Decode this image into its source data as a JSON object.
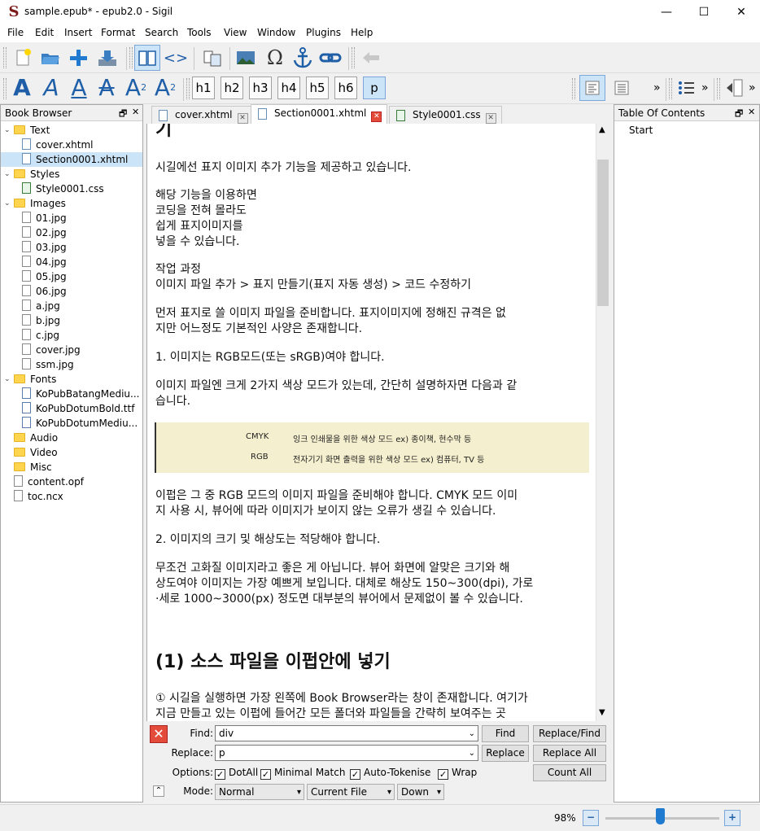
{
  "window": {
    "title": "sample.epub* - epub2.0 - Sigil",
    "logo_glyph": "S",
    "minimize_glyph": "—",
    "maximize_glyph": "☐",
    "close_glyph": "✕"
  },
  "menu": [
    "File",
    "Edit",
    "Insert",
    "Format",
    "Search",
    "Tools",
    "View",
    "Window",
    "Plugins",
    "Help"
  ],
  "toolbar_headings": [
    "h1",
    "h2",
    "h3",
    "h4",
    "h5",
    "h6",
    "p"
  ],
  "toolbar_omega": "Ω",
  "toolbar_more": "»",
  "book_browser": {
    "title": "Book Browser",
    "float_glyph": "🗗",
    "close_glyph": "✕",
    "items": [
      {
        "label": "Text",
        "kind": "folder",
        "level": 0
      },
      {
        "label": "cover.xhtml",
        "kind": "xhtml",
        "level": 1
      },
      {
        "label": "Section0001.xhtml",
        "kind": "xhtml",
        "level": 1,
        "selected": true
      },
      {
        "label": "Styles",
        "kind": "folder",
        "level": 0
      },
      {
        "label": "Style0001.css",
        "kind": "css",
        "level": 1
      },
      {
        "label": "Images",
        "kind": "folder",
        "level": 0
      },
      {
        "label": "01.jpg",
        "kind": "file",
        "level": 1
      },
      {
        "label": "02.jpg",
        "kind": "file",
        "level": 1
      },
      {
        "label": "03.jpg",
        "kind": "file",
        "level": 1
      },
      {
        "label": "04.jpg",
        "kind": "file",
        "level": 1
      },
      {
        "label": "05.jpg",
        "kind": "file",
        "level": 1
      },
      {
        "label": "06.jpg",
        "kind": "file",
        "level": 1
      },
      {
        "label": "a.jpg",
        "kind": "file",
        "level": 1
      },
      {
        "label": "b.jpg",
        "kind": "file",
        "level": 1
      },
      {
        "label": "c.jpg",
        "kind": "file",
        "level": 1
      },
      {
        "label": "cover.jpg",
        "kind": "file",
        "level": 1
      },
      {
        "label": "ssm.jpg",
        "kind": "file",
        "level": 1
      },
      {
        "label": "Fonts",
        "kind": "folder",
        "level": 0
      },
      {
        "label": "KoPubBatangMediu...",
        "kind": "font",
        "level": 1
      },
      {
        "label": "KoPubDotumBold.ttf",
        "kind": "font",
        "level": 1
      },
      {
        "label": "KoPubDotumMediu...",
        "kind": "font",
        "level": 1
      },
      {
        "label": "Audio",
        "kind": "folder",
        "level": 0,
        "noexp": true
      },
      {
        "label": "Video",
        "kind": "folder",
        "level": 0,
        "noexp": true
      },
      {
        "label": "Misc",
        "kind": "folder",
        "level": 0,
        "noexp": true
      },
      {
        "label": "content.opf",
        "kind": "file",
        "level": 0
      },
      {
        "label": "toc.ncx",
        "kind": "file",
        "level": 0
      }
    ]
  },
  "tabs": [
    {
      "label": "cover.xhtml",
      "active": false
    },
    {
      "label": "Section0001.xhtml",
      "active": true
    },
    {
      "label": "Style0001.css",
      "active": false
    }
  ],
  "tab_close_glyph": "✕",
  "toc": {
    "title": "Table Of Contents",
    "float_glyph": "🗗",
    "close_glyph": "✕",
    "items": [
      "Start"
    ]
  },
  "editor": {
    "heading_partial": "기",
    "p1": "시길에선 표지 이미지 추가 기능을 제공하고 있습니다.",
    "p2_lines": [
      "해당 기능을 이용하면",
      "코딩을 전혀 몰라도",
      "쉽게 표지이미지를",
      "넣을 수 있습니다."
    ],
    "p3_lines": [
      "작업 과정",
      "이미지 파일 추가 > 표지 만들기(표지 자동 생성) > 코드 수정하기"
    ],
    "p4_lines": [
      "먼저 표지로 쓸 이미지 파일을 준비합니다. 표지이미지에 정해진 규격은 없",
      "지만 어느정도 기본적인 사양은 존재합니다."
    ],
    "p5": "1. 이미지는 RGB모드(또는 sRGB)여야 합니다.",
    "p6_lines": [
      "이미지 파일엔 크게 2가지 색상 모드가 있는데, 간단히 설명하자면 다음과 같",
      "습니다."
    ],
    "table_rows": [
      {
        "mode": "CMYK",
        "desc": "잉크 인쇄물을 위한 색상 모드 ex) 종이책, 현수막 등"
      },
      {
        "mode": "RGB",
        "desc": "전자기기 화면 출력을 위한 색상 모드 ex) 컴퓨터, TV 등"
      }
    ],
    "p7_lines": [
      "이펍은 그 중 RGB 모드의 이미지 파일을 준비해야 합니다. CMYK 모드 이미",
      "지 사용 시, 뷰어에 따라 이미지가 보이지 않는 오류가 생길 수 있습니다."
    ],
    "p8": "2. 이미지의 크기 및 해상도는 적당해야 합니다.",
    "p9_lines": [
      "무조건 고화질 이미지라고 좋은 게 아닙니다. 뷰어 화면에 알맞은 크기와 해",
      "상도여야 이미지는 가장 예쁘게 보입니다. 대체로 해상도 150~300(dpi), 가로",
      "·세로 1000~3000(px) 정도면 대부분의 뷰어에서 문제없이 볼 수 있습니다."
    ],
    "heading2": "(1) 소스 파일을 이펍안에 넣기",
    "p10_lines": [
      "① 시길을 실행하면 가장 왼쪽에 Book Browser라는 창이 존재합니다. 여기가",
      "지금 만들고 있는 이펍에 들어간 모든 폴더와 파일들을 간략히 보여주는 곳"
    ]
  },
  "findbar": {
    "find_label": "Find:",
    "find_value": "div",
    "replace_label": "Replace:",
    "replace_value": "p",
    "options_label": "Options:",
    "options": [
      {
        "label": "DotAll",
        "checked": true
      },
      {
        "label": "Minimal Match",
        "checked": true
      },
      {
        "label": "Auto-Tokenise",
        "checked": true
      },
      {
        "label": "Wrap",
        "checked": true
      }
    ],
    "mode_label": "Mode:",
    "mode_value": "Normal",
    "scope_value": "Current File",
    "direction_value": "Down",
    "buttons": {
      "find": "Find",
      "replace_find": "Replace/Find",
      "replace": "Replace",
      "replace_all": "Replace All",
      "count_all": "Count All"
    },
    "close_glyph": "✕",
    "collapse_glyph": "⌃",
    "dropdown_glyph": "⌄",
    "combo_glyph": "▾",
    "check_glyph": "✓"
  },
  "status": {
    "zoom": "98%",
    "zoom_out_glyph": "−",
    "zoom_in_glyph": "+"
  },
  "colors": {
    "accent": "#1f5fa8",
    "close_red": "#e34b3a",
    "selection": "#cce4f7"
  }
}
